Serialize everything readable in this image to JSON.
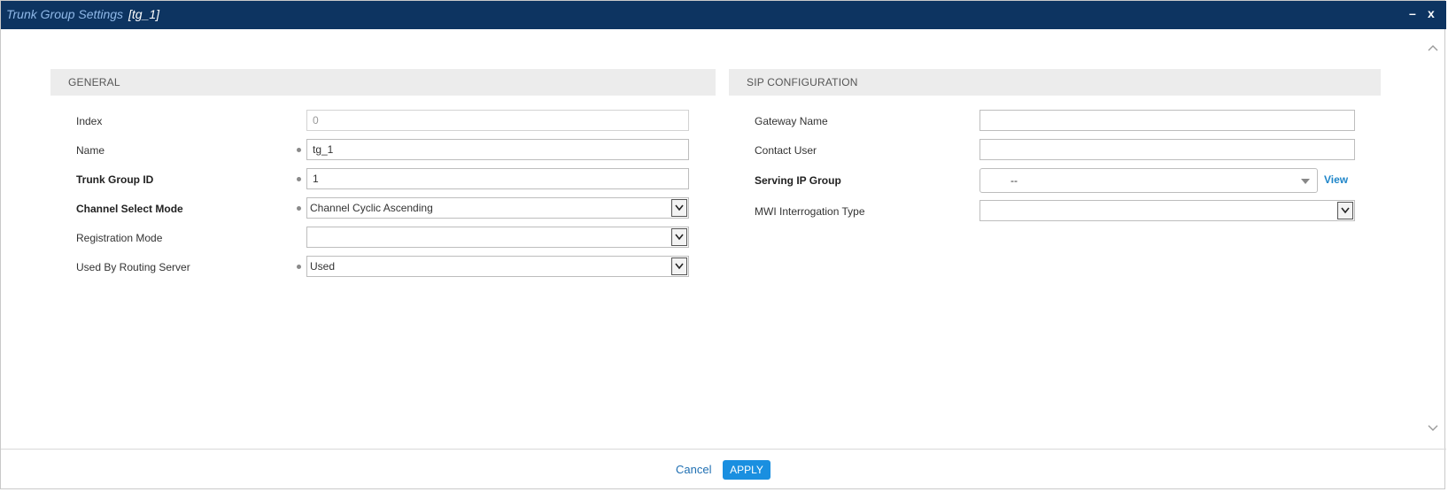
{
  "dialog": {
    "title": "Trunk Group Settings",
    "subtitle": "[tg_1]",
    "minimize": "–",
    "close": "x"
  },
  "general": {
    "header": "GENERAL",
    "fields": {
      "index": {
        "label": "Index",
        "value": "0"
      },
      "name": {
        "label": "Name",
        "value": "tg_1"
      },
      "trunk_group_id": {
        "label": "Trunk Group ID",
        "value": "1"
      },
      "channel_select_mode": {
        "label": "Channel Select Mode",
        "value": "Channel Cyclic Ascending"
      },
      "registration_mode": {
        "label": "Registration Mode",
        "value": ""
      },
      "used_by_routing_server": {
        "label": "Used By Routing Server",
        "value": "Used"
      }
    }
  },
  "sip": {
    "header": "SIP CONFIGURATION",
    "fields": {
      "gateway_name": {
        "label": "Gateway Name",
        "value": ""
      },
      "contact_user": {
        "label": "Contact User",
        "value": ""
      },
      "serving_ip_group": {
        "label": "Serving IP Group",
        "value": "--",
        "link": "View"
      },
      "mwi_interrogation_type": {
        "label": "MWI Interrogation Type",
        "value": ""
      }
    }
  },
  "footer": {
    "cancel": "Cancel",
    "apply": "APPLY"
  },
  "colors": {
    "titlebar": "#0d3461",
    "accent": "#1a8fe0",
    "section_header_bg": "#ececec"
  }
}
